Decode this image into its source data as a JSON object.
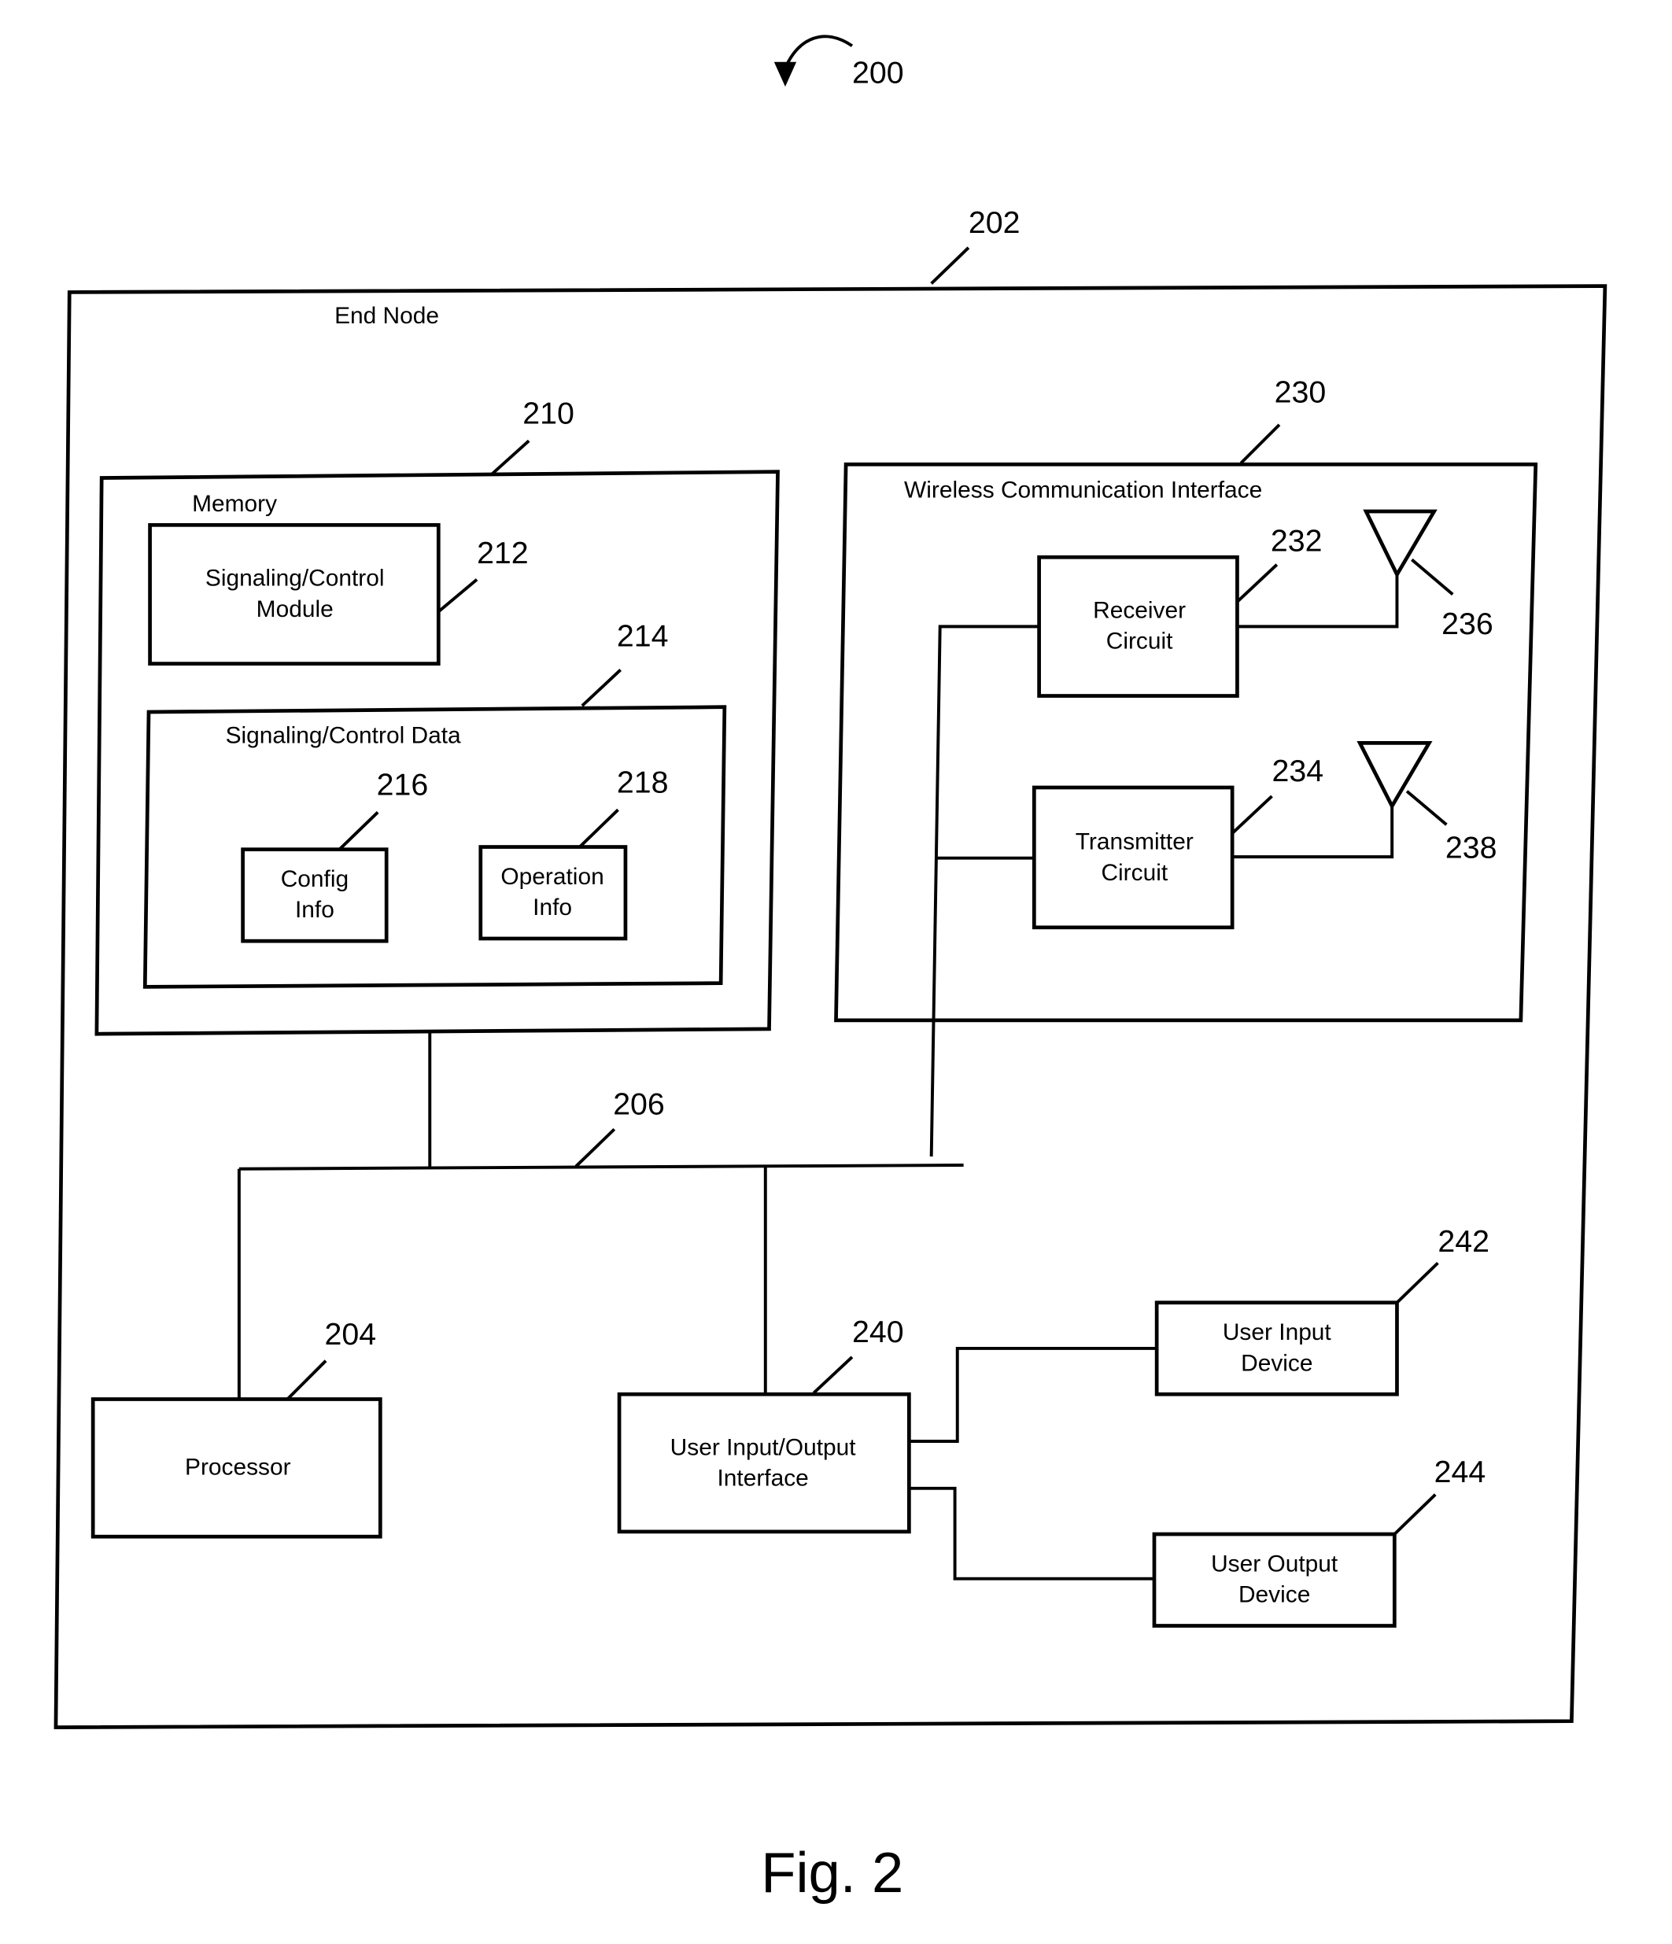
{
  "figure": {
    "caption": "Fig. 2",
    "ref": "200"
  },
  "end_node": {
    "title": "End Node",
    "ref": "202"
  },
  "memory": {
    "title": "Memory",
    "ref": "210",
    "module": {
      "line1": "Signaling/Control",
      "line2": "Module",
      "ref": "212"
    },
    "data": {
      "title": "Signaling/Control  Data",
      "ref": "214",
      "config": {
        "line1": "Config",
        "line2": "Info",
        "ref": "216"
      },
      "operation": {
        "line1": "Operation",
        "line2": "Info",
        "ref": "218"
      }
    }
  },
  "wireless": {
    "title": "Wireless Communication Interface",
    "ref": "230",
    "receiver": {
      "line1": "Receiver",
      "line2": "Circuit",
      "ref": "232",
      "antenna_ref": "236"
    },
    "transmitter": {
      "line1": "Transmitter",
      "line2": "Circuit",
      "ref": "234",
      "antenna_ref": "238"
    }
  },
  "bus": {
    "ref": "206"
  },
  "processor": {
    "label": "Processor",
    "ref": "204"
  },
  "io_interface": {
    "line1": "User Input/Output",
    "line2": "Interface",
    "ref": "240"
  },
  "input_device": {
    "line1": "User Input",
    "line2": "Device",
    "ref": "242"
  },
  "output_device": {
    "line1": "User Output",
    "line2": "Device",
    "ref": "244"
  }
}
